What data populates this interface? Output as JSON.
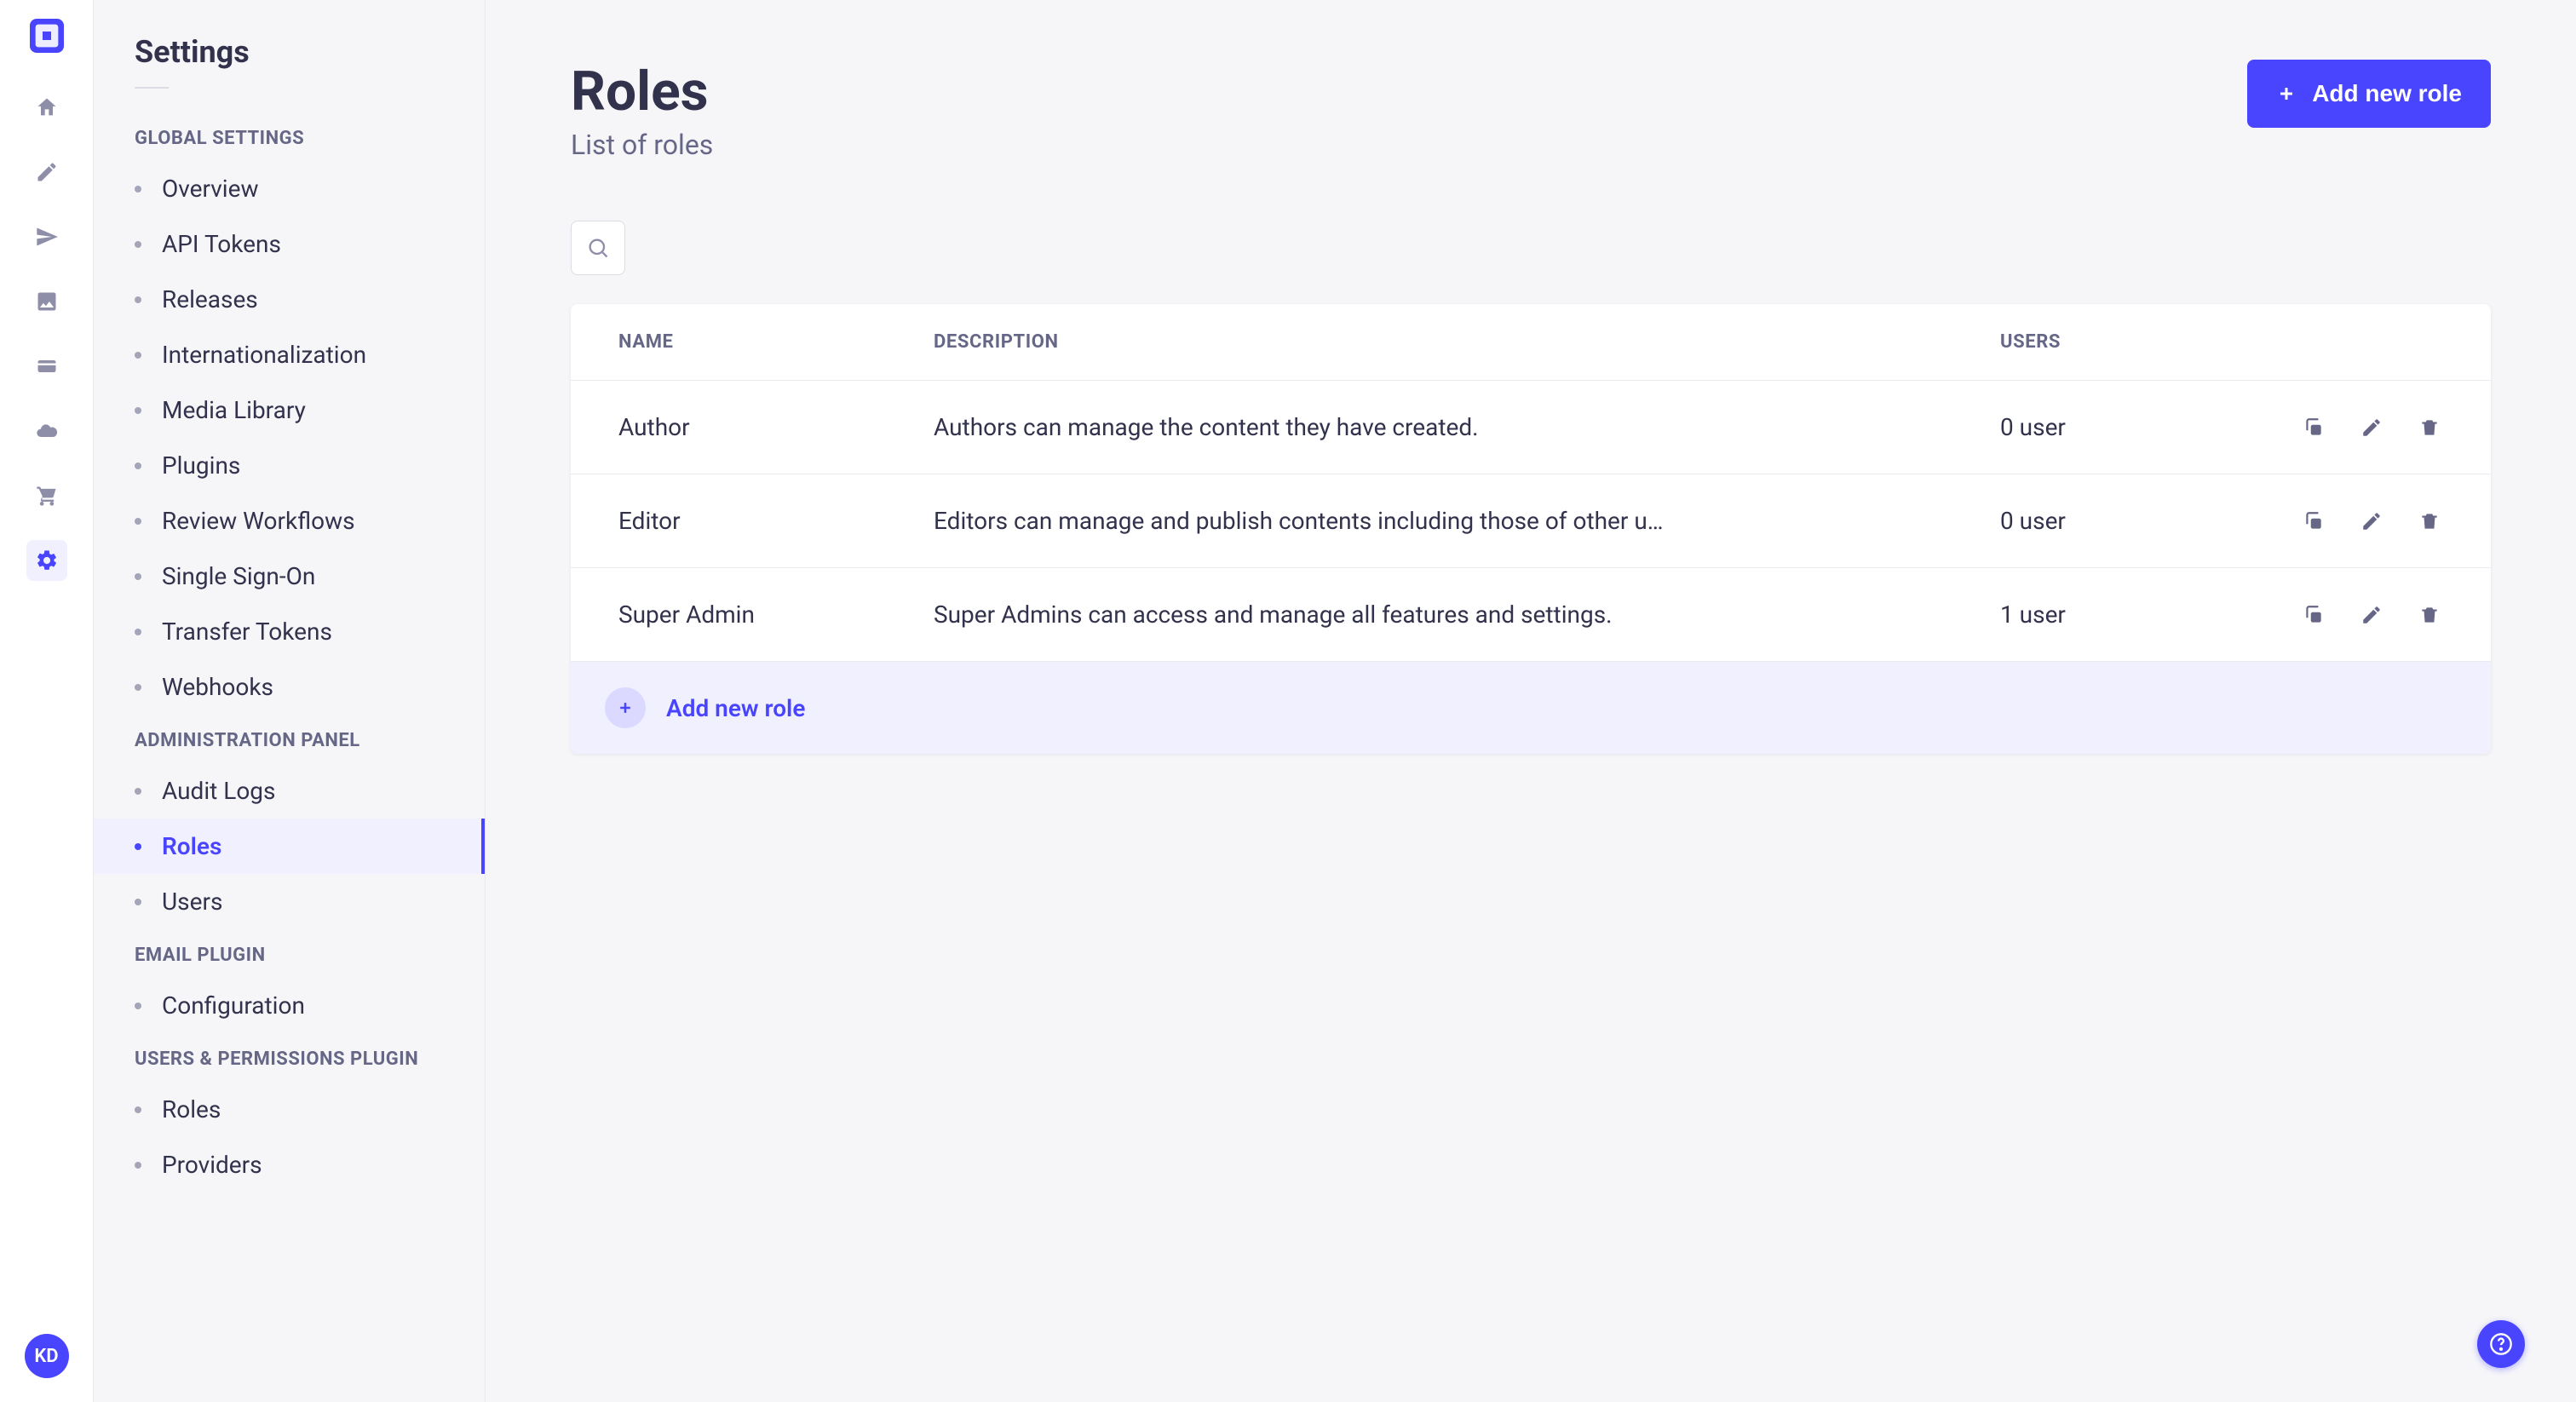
{
  "rail": {
    "avatar_initials": "KD"
  },
  "sidebar": {
    "title": "Settings",
    "sections": [
      {
        "header": "GLOBAL SETTINGS",
        "items": [
          {
            "label": "Overview"
          },
          {
            "label": "API Tokens"
          },
          {
            "label": "Releases"
          },
          {
            "label": "Internationalization"
          },
          {
            "label": "Media Library"
          },
          {
            "label": "Plugins"
          },
          {
            "label": "Review Workflows"
          },
          {
            "label": "Single Sign-On"
          },
          {
            "label": "Transfer Tokens"
          },
          {
            "label": "Webhooks"
          }
        ]
      },
      {
        "header": "ADMINISTRATION PANEL",
        "items": [
          {
            "label": "Audit Logs"
          },
          {
            "label": "Roles",
            "active": true
          },
          {
            "label": "Users"
          }
        ]
      },
      {
        "header": "EMAIL PLUGIN",
        "items": [
          {
            "label": "Configuration"
          }
        ]
      },
      {
        "header": "USERS & PERMISSIONS PLUGIN",
        "items": [
          {
            "label": "Roles"
          },
          {
            "label": "Providers"
          }
        ]
      }
    ]
  },
  "page": {
    "title": "Roles",
    "subtitle": "List of roles",
    "add_button_label": "Add new role"
  },
  "table": {
    "columns": {
      "name": "NAME",
      "description": "DESCRIPTION",
      "users": "USERS"
    },
    "rows": [
      {
        "name": "Author",
        "description": "Authors can manage the content they have created.",
        "users": "0 user"
      },
      {
        "name": "Editor",
        "description": "Editors can manage and publish contents including those of other u…",
        "users": "0 user"
      },
      {
        "name": "Super Admin",
        "description": "Super Admins can access and manage all features and settings.",
        "users": "1 user"
      }
    ],
    "footer_label": "Add new role"
  }
}
